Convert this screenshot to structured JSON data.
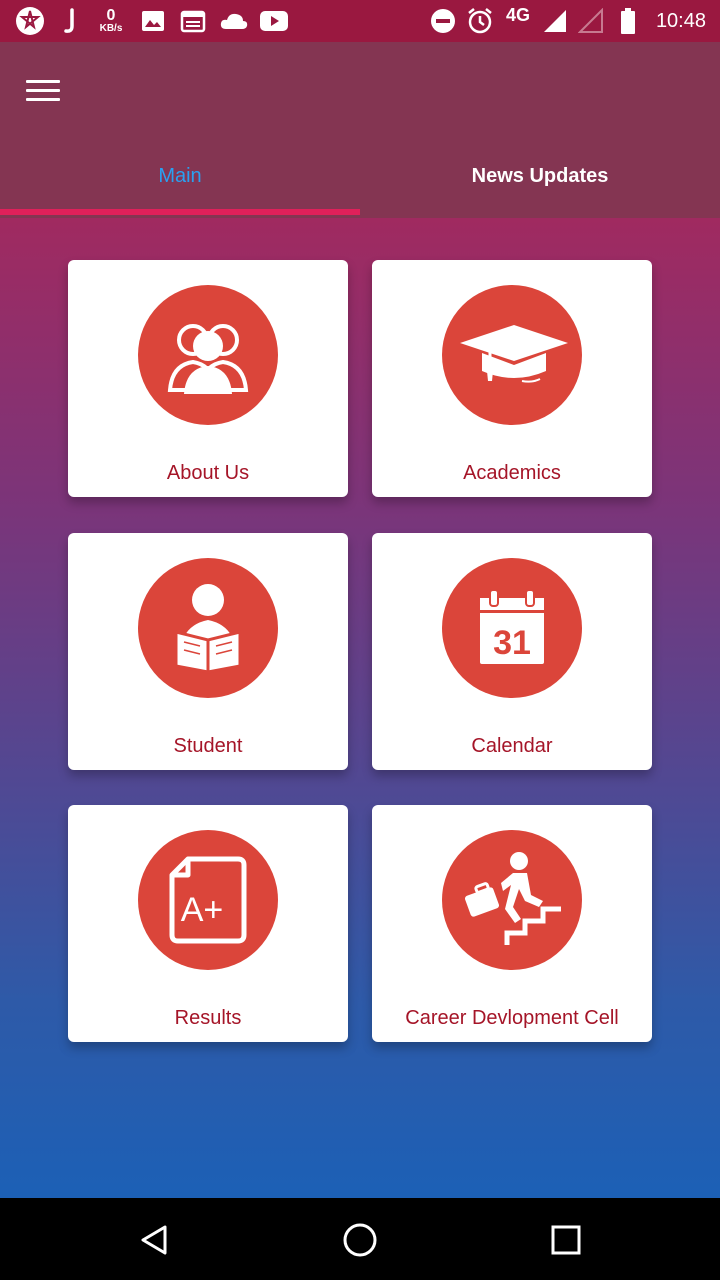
{
  "status_bar": {
    "time": "10:48",
    "data_rate_value": "0",
    "data_rate_unit": "KB/s",
    "network_type": "4G",
    "icons": [
      "app-badge-icon",
      "j-icon",
      "image-icon",
      "calendar-icon",
      "cloud-icon",
      "youtube-icon",
      "do-not-disturb-icon",
      "alarm-icon",
      "signal-icon",
      "signal-empty-icon",
      "battery-icon"
    ]
  },
  "app_bar": {
    "menu_icon": "hamburger-menu-icon"
  },
  "tabs": [
    {
      "label": "Main",
      "active": true
    },
    {
      "label": "News Updates",
      "active": false
    }
  ],
  "tiles": [
    {
      "label": "About Us",
      "icon": "people-group-icon"
    },
    {
      "label": "Academics",
      "icon": "graduation-cap-icon"
    },
    {
      "label": "Student",
      "icon": "student-reading-icon"
    },
    {
      "label": "Calendar",
      "icon": "calendar-31-icon",
      "icon_text": "31"
    },
    {
      "label": "Results",
      "icon": "grade-a-plus-icon",
      "icon_text": "A+"
    },
    {
      "label": "Career Devlopment Cell",
      "icon": "career-stairs-icon"
    }
  ],
  "colors": {
    "status_bar": "#9a1840",
    "app_bar": "#843552",
    "active_tab": "#2aa0f0",
    "tab_indicator": "#e0205a",
    "icon_circle": "#db453a",
    "tile_label": "#a51528"
  },
  "nav_bar": {
    "buttons": [
      "back-icon",
      "home-icon",
      "recents-icon"
    ]
  }
}
